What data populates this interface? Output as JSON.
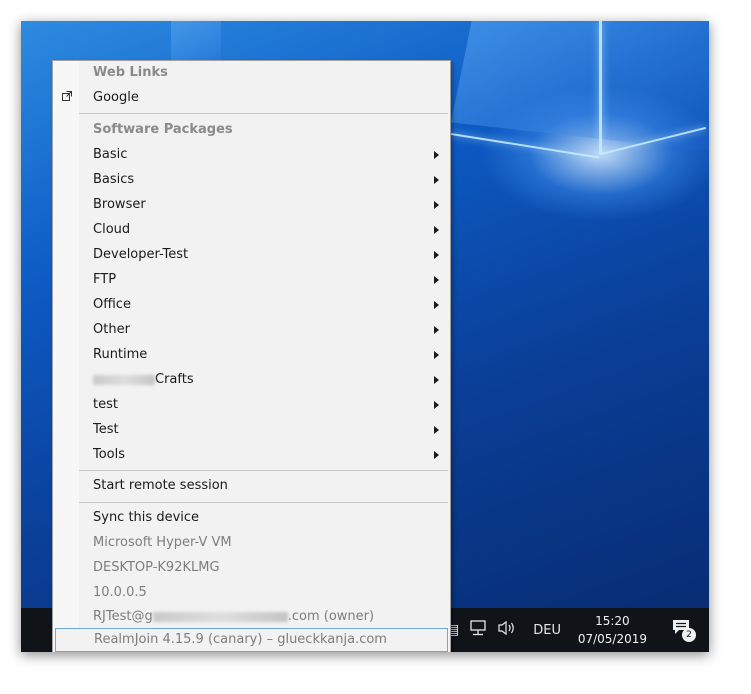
{
  "menu": {
    "web_links_header": "Web Links",
    "google": "Google",
    "software_header": "Software Packages",
    "packages": [
      "Basic",
      "Basics",
      "Browser",
      "Cloud",
      "Developer-Test",
      "FTP",
      "Office",
      "Other",
      "Runtime",
      "Crafts",
      "test",
      "Test",
      "Tools"
    ],
    "crafts_visible_suffix": "rafts",
    "start_remote": "Start remote session",
    "sync_device": "Sync this device",
    "device_model": "Microsoft Hyper-V VM",
    "device_name": "DESKTOP-K92KLMG",
    "device_version": "10.0.0.5",
    "user_prefix": "RJTest@g",
    "user_suffix": ".com (owner)",
    "footer": "RealmJoin 4.15.9 (canary) – glueckkanja.com"
  },
  "taskbar": {
    "language": "DEU",
    "time": "15:20",
    "date": "07/05/2019",
    "notification_count": "2"
  },
  "icons": {
    "external_link": "external-link-icon",
    "network": "network-icon",
    "volume": "volume-icon",
    "notifications": "action-center-icon"
  }
}
